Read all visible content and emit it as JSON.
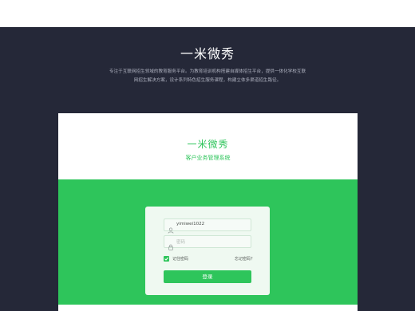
{
  "hero": {
    "title": "一米微秀",
    "description": "专注于互联网招生领域的教育服务平台。为教育培训机构搭建自媒体招生平台，提供一体化学校互联网招生解决方案，设计系列特色招生服务课程，构建立体多渠道招生路径。"
  },
  "card": {
    "brand_title": "一米微秀",
    "brand_subtitle": "客户业务管理系统"
  },
  "login": {
    "username_value": "yimiwei1022",
    "password_placeholder": "密码",
    "remember_label": "记住密码",
    "remember_checked": true,
    "forgot_label": "忘记密码？",
    "submit_label": "登录"
  },
  "colors": {
    "accent": "#2ec55b",
    "hero_bg": "#252838"
  },
  "icons": {
    "user": "user-icon",
    "password": "lock-icon",
    "check": "checkmark-icon"
  }
}
